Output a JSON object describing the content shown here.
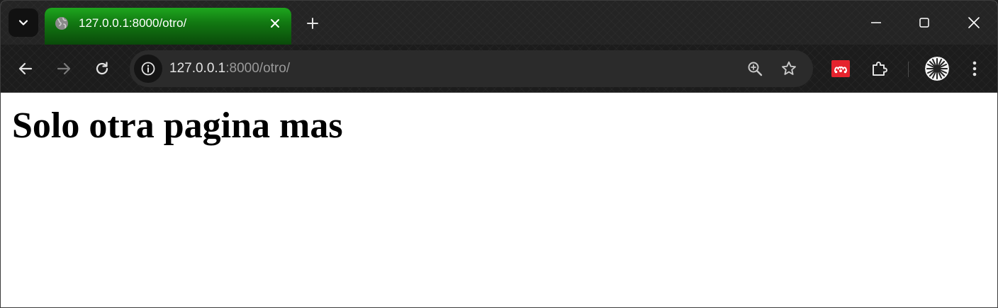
{
  "browser": {
    "tab": {
      "title": "127.0.0.1:8000/otro/",
      "favicon": "globe-icon",
      "accent": "#1ea61e"
    },
    "address_bar": {
      "host": "127.0.0.1",
      "path": ":8000/otro/"
    },
    "icons": {
      "tab_search": "chevron-down-icon",
      "new_tab": "plus-icon",
      "back": "arrow-left-icon",
      "forward": "arrow-right-icon",
      "reload": "reload-icon",
      "site_info": "info-icon",
      "zoom": "zoom-in-icon",
      "bookmark": "star-icon",
      "extension_1": "mendeley-icon",
      "extensions": "puzzle-icon",
      "profile": "avatar",
      "menu": "more-vert-icon",
      "minimize": "minimize-icon",
      "maximize": "maximize-icon",
      "close": "close-icon"
    },
    "colors": {
      "frame": "#242424",
      "omnibox": "#2b2b2b",
      "extension_red": "#e5232e"
    }
  },
  "page": {
    "heading": "Solo otra pagina mas"
  }
}
